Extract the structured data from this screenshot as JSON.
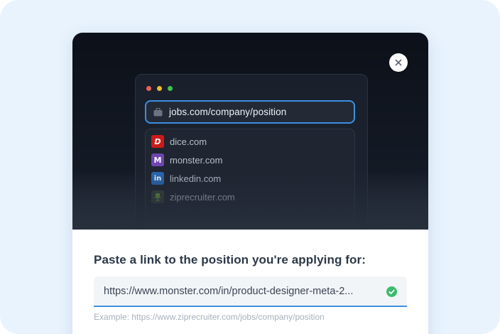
{
  "browser_preview": {
    "url": "jobs.com/company/position",
    "suggestions": [
      {
        "label": "dice.com",
        "glyph": "D",
        "color": "#cc1a1a",
        "icon": "dice-logo-icon"
      },
      {
        "label": "monster.com",
        "glyph": "M",
        "color": "#6e46ae",
        "icon": "monster-logo-icon"
      },
      {
        "label": "linkedin.com",
        "glyph": "in",
        "color": "#2867b2",
        "icon": "linkedin-logo-icon"
      },
      {
        "label": "ziprecruiter.com",
        "glyph": "",
        "color": "#3a4a3a",
        "icon": "ziprecruiter-logo-icon"
      }
    ],
    "window_dot_colors": [
      "#ee5f57",
      "#f2bb2e",
      "#3fc64a"
    ]
  },
  "form": {
    "heading": "Paste a link to the position you're applying for:",
    "input_value": "https://www.monster.com/in/product-designer-meta-2...",
    "example": "Example: https://www.ziprecruiter.com/jobs/company/position"
  },
  "colors": {
    "accent_blue": "#3f8fe0",
    "success_green": "#3dbb6e",
    "page_background": "#e8f3fd"
  },
  "icons": {
    "close": "close-icon",
    "url_bar": "briefcase-icon",
    "valid": "check-circle-icon"
  }
}
